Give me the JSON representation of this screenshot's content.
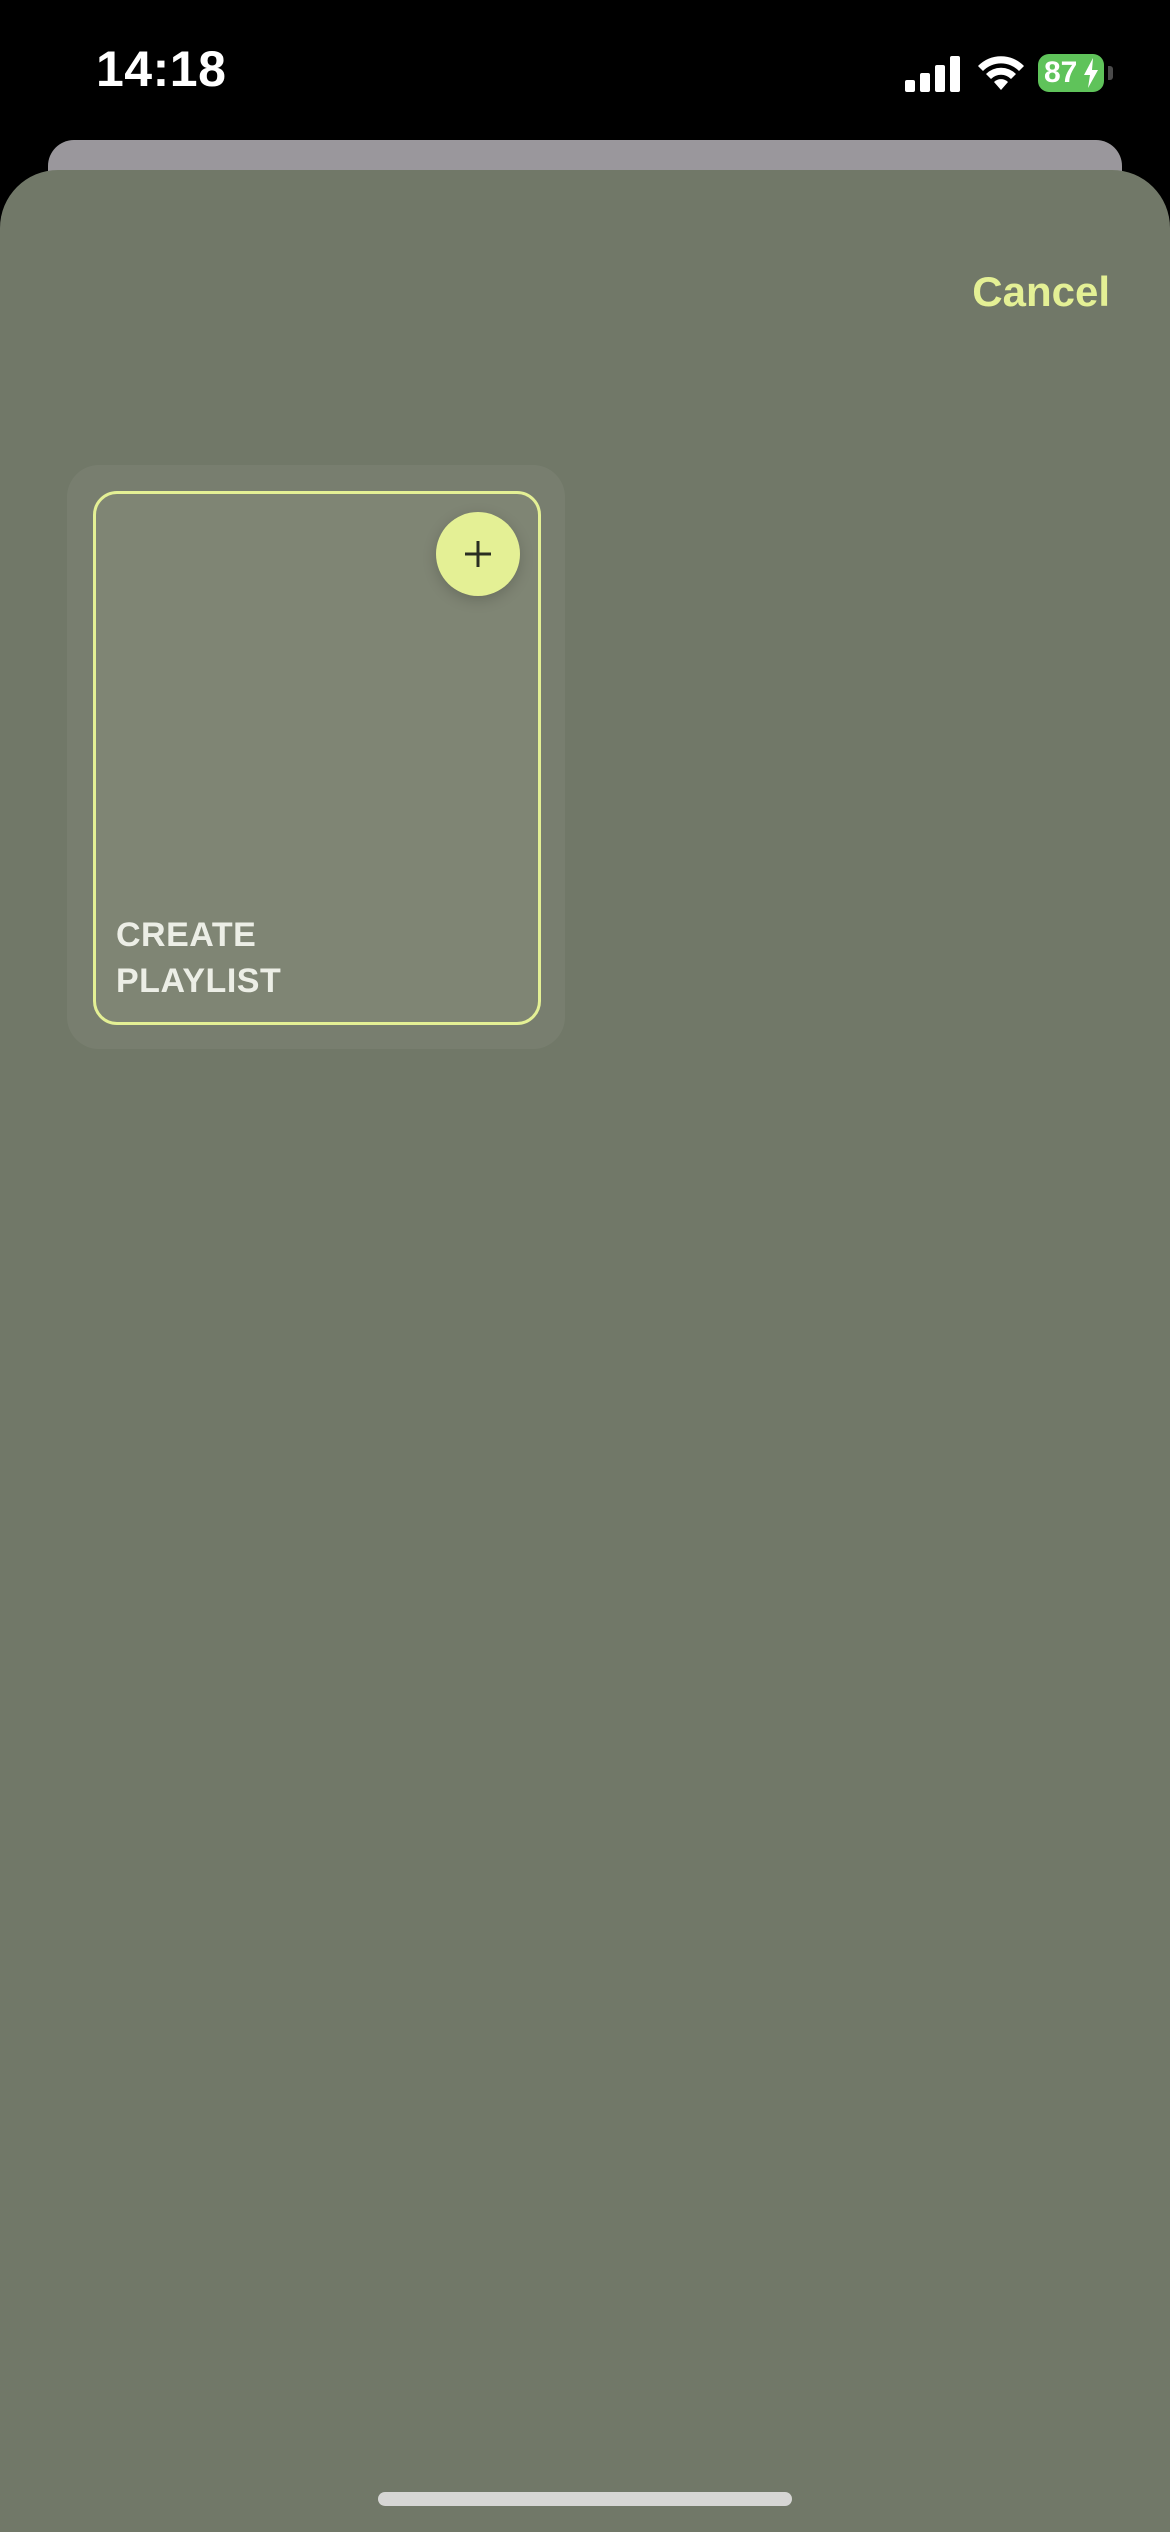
{
  "status_bar": {
    "time": "14:18",
    "battery_level": "87",
    "icons": [
      "signal-icon",
      "wifi-icon",
      "battery-icon",
      "charging-bolt-icon"
    ]
  },
  "sheet": {
    "cancel_label": "Cancel"
  },
  "create_tile": {
    "label_line1": "CREATE",
    "label_line2": "PLAYLIST",
    "icon": "plus-icon"
  },
  "colors": {
    "accent": "#e4f095",
    "sheet_background": "#717868",
    "tile_background": "#7f8574",
    "battery_green": "#5fc35a"
  }
}
